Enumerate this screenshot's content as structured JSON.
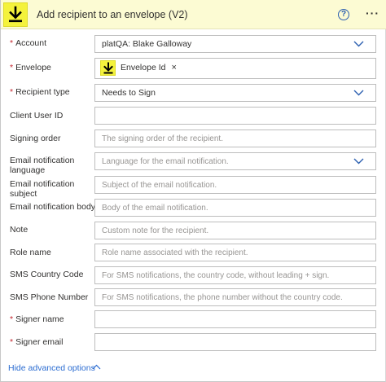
{
  "header": {
    "title": "Add recipient to an envelope (V2)",
    "help_glyph": "?",
    "more_glyph": "···",
    "brand_color": "#f4f23c",
    "logo_icon": "download-arrow-icon"
  },
  "fields": {
    "account": {
      "label": "Account",
      "required_mark": "*",
      "value": "platQA: Blake Galloway"
    },
    "envelope": {
      "label": "Envelope",
      "required_mark": "*",
      "token_label": "Envelope Id",
      "token_remove": "×"
    },
    "recipient_type": {
      "label": "Recipient type",
      "required_mark": "*",
      "value": "Needs to Sign"
    },
    "client_user_id": {
      "label": "Client User ID",
      "placeholder": ""
    },
    "signing_order": {
      "label": "Signing order",
      "placeholder": "The signing order of the recipient."
    },
    "email_language": {
      "label": "Email notification language",
      "placeholder": "Language for the email notification."
    },
    "email_subject": {
      "label": "Email notification subject",
      "placeholder": "Subject of the email notification."
    },
    "email_body": {
      "label": "Email notification body",
      "placeholder": "Body of the email notification."
    },
    "note": {
      "label": "Note",
      "placeholder": "Custom note for the recipient."
    },
    "role_name": {
      "label": "Role name",
      "placeholder": "Role name associated with the recipient."
    },
    "sms_country_code": {
      "label": "SMS Country Code",
      "placeholder": "For SMS notifications, the country code, without leading + sign."
    },
    "sms_phone_number": {
      "label": "SMS Phone Number",
      "placeholder": "For SMS notifications, the phone number without the country code."
    },
    "signer_name": {
      "label": "Signer name",
      "required_mark": "*",
      "placeholder": ""
    },
    "signer_email": {
      "label": "Signer email",
      "required_mark": "*",
      "placeholder": ""
    }
  },
  "footer": {
    "advanced_toggle": "Hide advanced options"
  }
}
